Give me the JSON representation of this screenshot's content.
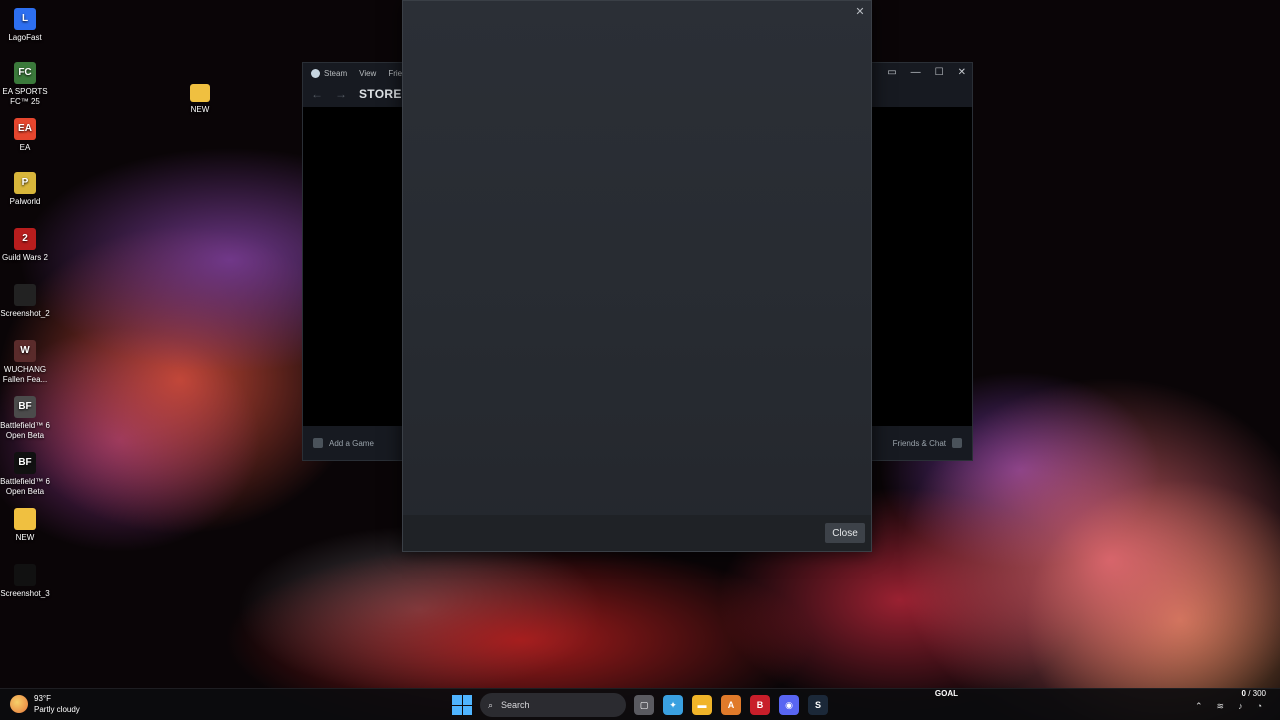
{
  "desktop": {
    "icons": [
      {
        "label": "LagoFast",
        "color": "#2d6ff0",
        "glyph": "L"
      },
      {
        "label": "EA SPORTS FC™ 25",
        "color": "#3b7a3b",
        "glyph": "FC"
      },
      {
        "label": "EA",
        "color": "#e5462e",
        "glyph": "EA"
      },
      {
        "label": "Palworld",
        "color": "#d8b63b",
        "glyph": "P"
      },
      {
        "label": "Guild Wars 2",
        "color": "#b81d1d",
        "glyph": "2"
      },
      {
        "label": "Screenshot_2",
        "color": "#222222",
        "glyph": ""
      },
      {
        "label": "WUCHANG Fallen Fea...",
        "color": "#5a2b2b",
        "glyph": "W"
      },
      {
        "label": "Battlefield™ 6 Open Beta",
        "color": "#4b4b4b",
        "glyph": "BF"
      },
      {
        "label": "Battlefield™ 6 Open Beta",
        "color": "#111111",
        "glyph": "BF"
      },
      {
        "label": "NEW",
        "color": "#f0c040",
        "glyph": ""
      },
      {
        "label": "Screenshot_3",
        "color": "#111111",
        "glyph": ""
      }
    ],
    "new_folder": {
      "label": "NEW",
      "color": "#f0c040"
    }
  },
  "steam": {
    "menu": [
      "Steam",
      "View",
      "Frien"
    ],
    "title": "STORE",
    "add_game": "Add a Game",
    "friends_chat": "Friends & Chat",
    "controls": [
      "▭",
      "—",
      "☐",
      "✕"
    ]
  },
  "dialog": {
    "close_x": "✕",
    "close_button": "Close"
  },
  "taskbar": {
    "weather_temp": "93°F",
    "weather_desc": "Partly cloudy",
    "search_placeholder": "Search",
    "apps": [
      {
        "name": "task-view",
        "color": "#5a5a60",
        "glyph": "▢"
      },
      {
        "name": "copilot",
        "color": "#3aa0e0",
        "glyph": "✦"
      },
      {
        "name": "file-explorer",
        "color": "#f0b429",
        "glyph": "▬"
      },
      {
        "name": "app-a",
        "color": "#e07a2a",
        "glyph": "A"
      },
      {
        "name": "app-red",
        "color": "#c81e2a",
        "glyph": "B"
      },
      {
        "name": "discord",
        "color": "#5865f2",
        "glyph": "◉"
      },
      {
        "name": "steam",
        "color": "#1b2838",
        "glyph": "S"
      }
    ],
    "goal_label": "GOAL",
    "goal_current": "0",
    "goal_total": "/ 300"
  }
}
